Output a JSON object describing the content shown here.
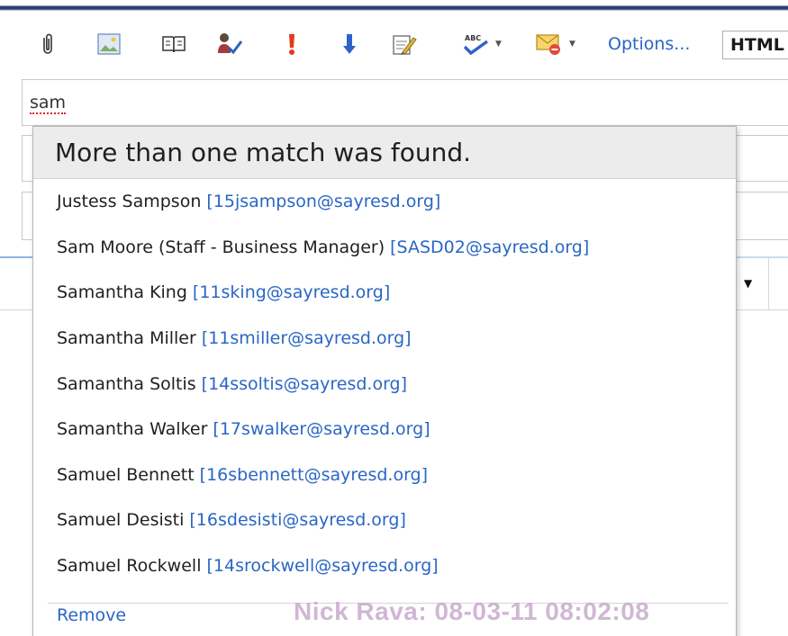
{
  "toolbar": {
    "icons": [
      "attach-icon",
      "insert-picture-icon",
      "address-book-icon",
      "check-names-icon",
      "high-importance-icon",
      "low-importance-icon",
      "signature-icon",
      "spell-check-icon",
      "message-options-icon"
    ],
    "options_label": "Options...",
    "format_value": "HTML"
  },
  "to_field": {
    "value": "sam"
  },
  "popup": {
    "header": "More than one match was found.",
    "matches": [
      {
        "name": "Justess Sampson",
        "email": "[15jsampson@sayresd.org]"
      },
      {
        "name": "Sam Moore (Staff - Business Manager)",
        "email": "[SASD02@sayresd.org]"
      },
      {
        "name": "Samantha King",
        "email": "[11sking@sayresd.org]"
      },
      {
        "name": "Samantha Miller",
        "email": "[11smiller@sayresd.org]"
      },
      {
        "name": "Samantha Soltis",
        "email": "[14ssoltis@sayresd.org]"
      },
      {
        "name": "Samantha Walker",
        "email": "[17swalker@sayresd.org]"
      },
      {
        "name": "Samuel Bennett",
        "email": "[16sbennett@sayresd.org]"
      },
      {
        "name": "Samuel Desisti",
        "email": "[16sdesisti@sayresd.org]"
      },
      {
        "name": "Samuel Rockwell",
        "email": "[14srockwell@sayresd.org]"
      }
    ],
    "remove_label": "Remove"
  },
  "watermark": "Nick Rava: 08-03-11 08:02:08",
  "colors": {
    "link": "#2a66c4",
    "header_bg": "#ececec",
    "window_frame": "#2b3f73"
  }
}
